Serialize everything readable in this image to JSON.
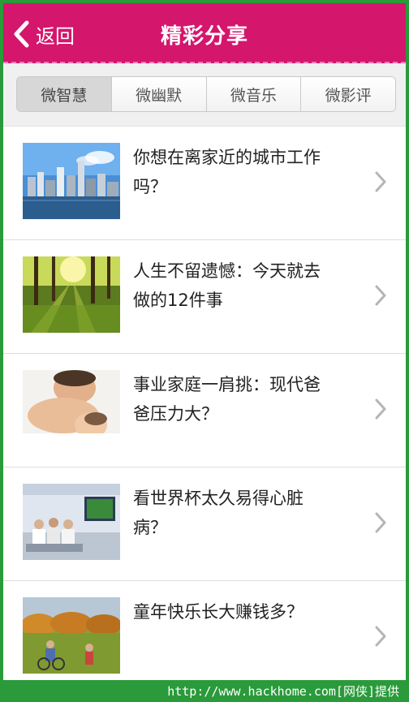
{
  "header": {
    "back_label": "返回",
    "title": "精彩分享"
  },
  "tabs": [
    {
      "label": "微智慧",
      "active": true
    },
    {
      "label": "微幽默",
      "active": false
    },
    {
      "label": "微音乐",
      "active": false
    },
    {
      "label": "微影评",
      "active": false
    }
  ],
  "items": [
    {
      "title": "你想在离家近的城市工作吗？",
      "thumb": "city-skyline-image"
    },
    {
      "title": "人生不留遗憾：今天就去做的12件事",
      "thumb": "sunlit-forest-image"
    },
    {
      "title": "事业家庭一肩挑：现代爸爸压力大？",
      "thumb": "father-baby-image"
    },
    {
      "title": "看世界杯太久易得心脏病？",
      "thumb": "tv-room-image"
    },
    {
      "title": "童年快乐长大赚钱多？",
      "thumb": "child-park-image"
    }
  ],
  "watermark": "http://www.hackhome.com[网侠]提供",
  "colors": {
    "header": "#d4166c",
    "border": "#2a9a3a"
  }
}
